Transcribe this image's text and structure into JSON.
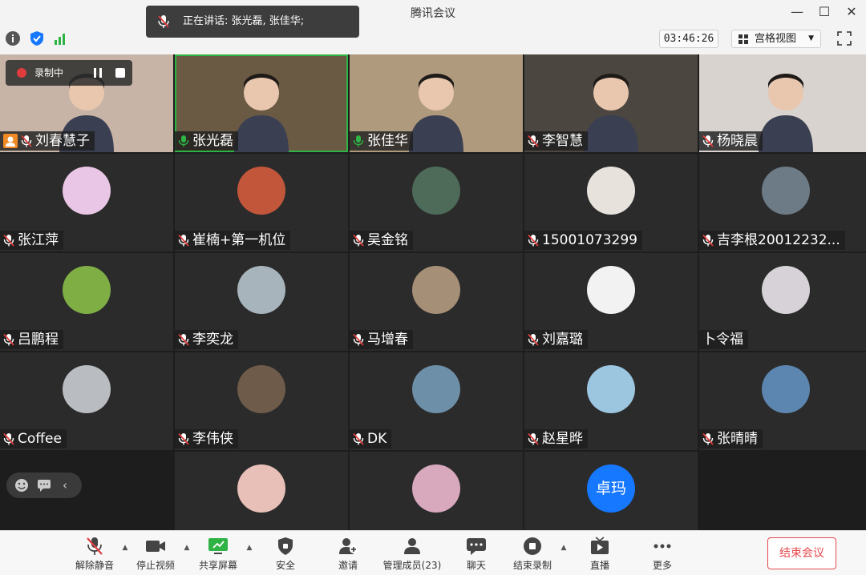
{
  "window": {
    "title": "腾讯会议"
  },
  "speaking": {
    "prefix": "正在讲话: ",
    "names": "张光磊, 张佳华;"
  },
  "infobar": {
    "timer": "03:46:26",
    "view_label": "宫格视图"
  },
  "recording": {
    "label": "录制中"
  },
  "participants": [
    {
      "name": "刘春慧子",
      "video": true,
      "mic": "muted",
      "tint": "#c8b4a6"
    },
    {
      "name": "张光磊",
      "video": true,
      "mic": "on",
      "tint": "#6a5a44",
      "active": true
    },
    {
      "name": "张佳华",
      "video": true,
      "mic": "on",
      "tint": "#b09a7e"
    },
    {
      "name": "李智慧",
      "video": true,
      "mic": "muted",
      "tint": "#4c4640"
    },
    {
      "name": "杨晓晨",
      "video": true,
      "mic": "muted",
      "tint": "#d9d3cf"
    },
    {
      "name": "张江萍",
      "mic": "muted",
      "avatar_color": "#e9c6e6"
    },
    {
      "name": "崔楠+第一机位",
      "mic": "muted",
      "avatar_color": "#c2563b"
    },
    {
      "name": "吴金铭",
      "mic": "muted",
      "avatar_color": "#4e6b5a"
    },
    {
      "name": "15001073299",
      "mic": "muted",
      "avatar_color": "#e7e2dc"
    },
    {
      "name": "吉李根20012232...",
      "mic": "muted",
      "avatar_color": "#6c7b86"
    },
    {
      "name": "吕鹏程",
      "mic": "muted",
      "avatar_color": "#7fae45"
    },
    {
      "name": "李奕龙",
      "mic": "muted",
      "avatar_color": "#a7b4bb"
    },
    {
      "name": "马增春",
      "mic": "muted",
      "avatar_color": "#a58f76"
    },
    {
      "name": "刘嘉璐",
      "mic": "muted",
      "avatar_color": "#f2f2f2"
    },
    {
      "name": "卜令福",
      "mic": "none",
      "avatar_color": "#d7d2d7"
    },
    {
      "name": "Coffee",
      "mic": "muted",
      "avatar_color": "#b9bcc0"
    },
    {
      "name": "李伟侠",
      "mic": "muted",
      "avatar_color": "#6f5b4a"
    },
    {
      "name": "DK",
      "mic": "muted",
      "avatar_color": "#6d8fa8"
    },
    {
      "name": "赵星晔",
      "mic": "muted",
      "avatar_color": "#9cc6e0"
    },
    {
      "name": "张晴晴",
      "mic": "muted",
      "avatar_color": "#5c86b0"
    },
    {
      "name": "",
      "empty": true
    },
    {
      "name": "",
      "mic": "muted",
      "avatar_color": "#e8c0b8"
    },
    {
      "name": "",
      "mic": "muted",
      "avatar_color": "#d8a8bd"
    },
    {
      "name": "",
      "mic": "muted",
      "avatar_text": "卓玛",
      "avatar_color": "#1677ff"
    },
    {
      "name": "",
      "empty": true
    }
  ],
  "toolbar": {
    "mute": "解除静音",
    "video": "停止视频",
    "share": "共享屏幕",
    "security": "安全",
    "invite": "邀请",
    "members": "管理成员(23)",
    "chat": "聊天",
    "record": "结束录制",
    "live": "直播",
    "more": "更多",
    "end": "结束会议"
  },
  "colors": {
    "accent_green": "#2fb344",
    "end_red": "#e5484d",
    "muted_red": "#e03c3c"
  }
}
